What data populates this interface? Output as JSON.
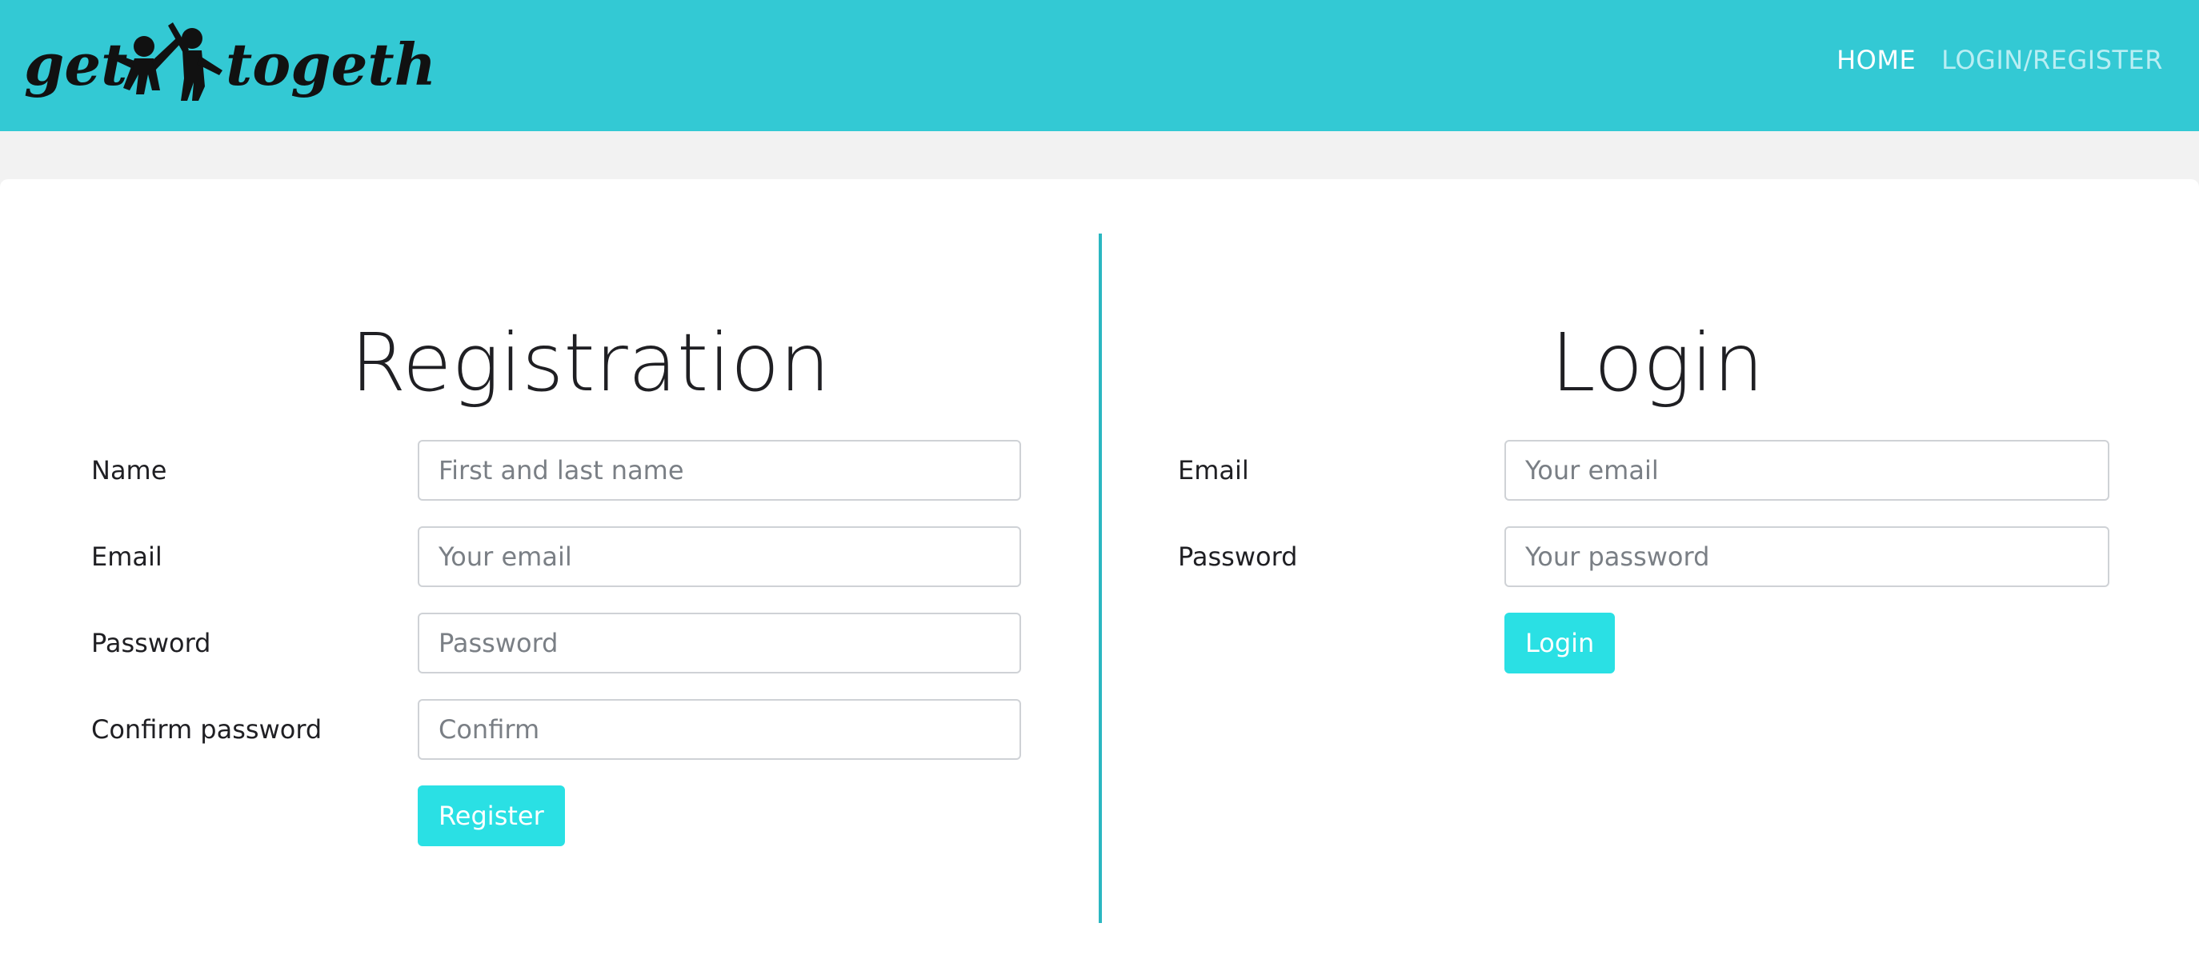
{
  "header": {
    "logo_text_left": "get",
    "logo_text_right": "together",
    "logo_alt": "get together logo",
    "nav": [
      {
        "label": "HOME",
        "active": true
      },
      {
        "label": "LOGIN/REGISTER",
        "active": false
      }
    ]
  },
  "registration": {
    "title": "Registration",
    "fields": [
      {
        "label": "Name",
        "placeholder": "First and last name",
        "value": ""
      },
      {
        "label": "Email",
        "placeholder": "Your email",
        "value": ""
      },
      {
        "label": "Password",
        "placeholder": "Password",
        "value": ""
      },
      {
        "label": "Confirm password",
        "placeholder": "Confirm",
        "value": ""
      }
    ],
    "submit_label": "Register"
  },
  "login": {
    "title": "Login",
    "fields": [
      {
        "label": "Email",
        "placeholder": "Your email",
        "value": ""
      },
      {
        "label": "Password",
        "placeholder": "Your password",
        "value": ""
      }
    ],
    "submit_label": "Login"
  },
  "colors": {
    "header_bg": "#33c9d4",
    "accent_button": "#2ae0e4",
    "divider": "#2bb7c1",
    "page_bg": "#f2f2f2"
  }
}
